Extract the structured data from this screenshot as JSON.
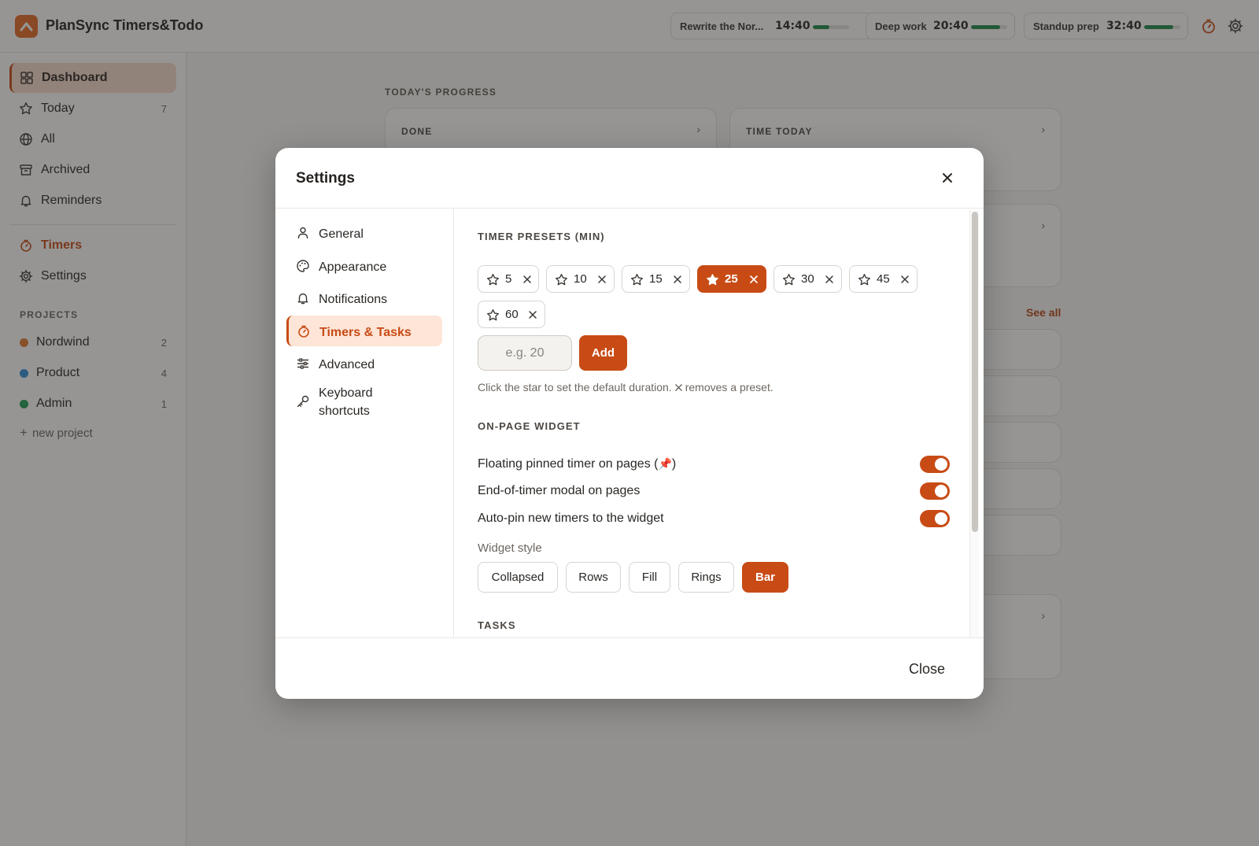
{
  "app": {
    "title": "PlanSync Timers&Todo"
  },
  "timers": [
    {
      "name": "Rewrite the Nor...",
      "time": "14:40",
      "progress": 0.45
    },
    {
      "name": "Deep work",
      "time": "20:40",
      "progress": 0.8
    },
    {
      "name": "Standup prep",
      "time": "32:40",
      "progress": 0.8
    }
  ],
  "sidebar": {
    "nav": [
      {
        "label": "Dashboard",
        "icon": "dashboard-icon",
        "count": ""
      },
      {
        "label": "Today",
        "icon": "star-icon",
        "count": "7"
      },
      {
        "label": "All",
        "icon": "globe-icon",
        "count": ""
      },
      {
        "label": "Archived",
        "icon": "archive-icon",
        "count": ""
      },
      {
        "label": "Reminders",
        "icon": "bell-icon",
        "count": ""
      }
    ],
    "timers_label": "Timers",
    "settings_label": "Settings",
    "projects_heading": "PROJECTS",
    "projects": [
      {
        "name": "Nordwind",
        "count": "2",
        "color": "#e07b2e"
      },
      {
        "name": "Product",
        "count": "4",
        "color": "#2f8fd6"
      },
      {
        "name": "Admin",
        "count": "1",
        "color": "#1f9d55"
      }
    ],
    "new_project": "new project"
  },
  "main": {
    "section_title": "TODAY'S PROGRESS",
    "card_done": "DONE",
    "card_time": "TIME TODAY",
    "see_all": "See all"
  },
  "settings_modal": {
    "title": "Settings",
    "nav": [
      {
        "label": "General",
        "icon": "user-icon"
      },
      {
        "label": "Appearance",
        "icon": "palette-icon"
      },
      {
        "label": "Notifications",
        "icon": "bell-icon"
      },
      {
        "label": "Timers & Tasks",
        "icon": "timer-icon"
      },
      {
        "label": "Advanced",
        "icon": "sliders-icon"
      },
      {
        "label": "Keyboard shortcuts",
        "icon": "key-icon"
      }
    ],
    "active_nav": "Timers & Tasks",
    "presets_heading": "TIMER PRESETS (MIN)",
    "presets": [
      "5",
      "10",
      "15",
      "25",
      "30",
      "45",
      "60"
    ],
    "default_preset": "25",
    "preset_input_placeholder": "e.g. 20",
    "add_label": "Add",
    "hint_before": "Click the star to set the default duration.",
    "hint_after": "removes a preset.",
    "widget_heading": "ON-PAGE WIDGET",
    "options": [
      {
        "label": "Floating pinned timer on pages (",
        "label_suffix": ")",
        "enabled": true
      },
      {
        "label": "End-of-timer modal on pages",
        "enabled": true
      },
      {
        "label": "Auto-pin new timers to the widget",
        "enabled": true
      }
    ],
    "widget_style_label": "Widget style",
    "widget_styles": [
      "Collapsed",
      "Rows",
      "Fill",
      "Rings",
      "Bar"
    ],
    "active_widget_style": "Bar",
    "tasks_heading": "TASKS",
    "close_label": "Close"
  },
  "colors": {
    "accent": "#c84b15",
    "progress": "#1f8a4c",
    "logo": "#e56a26"
  }
}
